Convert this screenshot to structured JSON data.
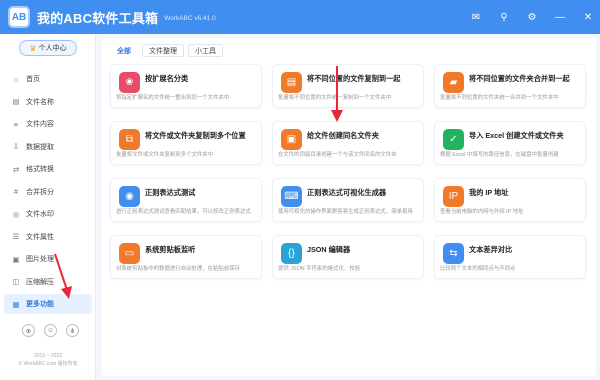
{
  "app": {
    "logo_text": "AB",
    "title": "我的ABC软件工具箱",
    "version": "WorkABC v6.41.0"
  },
  "window_controls": [
    {
      "name": "mail-icon",
      "glyph": "✉"
    },
    {
      "name": "pin-icon",
      "glyph": "⚲"
    },
    {
      "name": "settings-icon",
      "glyph": "⚙"
    },
    {
      "name": "minimize-icon",
      "glyph": "—"
    },
    {
      "name": "close-icon",
      "glyph": "✕"
    }
  ],
  "sidebar": {
    "vip_label": "个人中心",
    "items": [
      {
        "label": "首页",
        "icon": "⌂"
      },
      {
        "label": "文件名称",
        "icon": "▤"
      },
      {
        "label": "文件内容",
        "icon": "≡"
      },
      {
        "label": "数据提取",
        "icon": "⇩"
      },
      {
        "label": "格式转换",
        "icon": "⇄"
      },
      {
        "label": "合并拆分",
        "icon": "#"
      },
      {
        "label": "文件水印",
        "icon": "◎"
      },
      {
        "label": "文件属性",
        "icon": "☰"
      },
      {
        "label": "图片处理",
        "icon": "▣"
      },
      {
        "label": "压缩解压",
        "icon": "◫"
      },
      {
        "label": "更多功能",
        "icon": "▦",
        "active": true
      }
    ],
    "bottom_icons": [
      {
        "name": "link-icon",
        "glyph": "⊕"
      },
      {
        "name": "chat-icon",
        "glyph": "☺"
      },
      {
        "name": "share-icon",
        "glyph": "⋔"
      }
    ],
    "copyright_line1": "2013 ~ 2023",
    "copyright_line2": "© WorkABC.com 版权所有"
  },
  "tabs": [
    {
      "label": "全部",
      "active": true
    },
    {
      "label": "文件整理"
    },
    {
      "label": "小工具"
    }
  ],
  "cards": [
    {
      "title": "按扩展名分类",
      "desc": "将指定扩展名的文件统一整出到同一个文件夹中",
      "color": "pink",
      "glyph": "❀"
    },
    {
      "title": "将不同位置的文件复制到一起",
      "desc": "批量将不同位置的文件统一复制到一个文件夹中",
      "color": "orange",
      "glyph": "▤"
    },
    {
      "title": "将不同位置的文件夹合并到一起",
      "desc": "批量将不同位置的文件夹统一合并到一个文件夹中",
      "color": "orange",
      "glyph": "▰"
    },
    {
      "title": "将文件或文件夹复制到多个位置",
      "desc": "批量将文件或文件夹复制到多个文件夹中",
      "color": "orange",
      "glyph": "⧉"
    },
    {
      "title": "给文件创建同名文件夹",
      "desc": "在文件的同级目录创建一个与该文件同名的文件夹",
      "color": "orange",
      "glyph": "▣"
    },
    {
      "title": "导入 Excel 创建文件或文件夹",
      "desc": "根据 Excel 中填写的路径信息，在磁盘中批量创建",
      "color": "green",
      "glyph": "✓"
    },
    {
      "title": "正则表达式测试",
      "desc": "进行正则表达式测试查看匹配结果，可以修改正则表达式",
      "color": "blue",
      "glyph": "◉"
    },
    {
      "title": "正则表达式可视化生成器",
      "desc": "使用可视化的操作界面更容易生成正则表达式，简单易用",
      "color": "blue",
      "glyph": "⌨"
    },
    {
      "title": "我的 IP 地址",
      "desc": "查看当前电脑的内网与外网 IP 地址",
      "color": "orange",
      "glyph": "IP"
    },
    {
      "title": "系统剪贴板监听",
      "desc": "对系统剪贴板中的数据进行自动处理，在粘贴前保存",
      "color": "orange",
      "glyph": "▭"
    },
    {
      "title": "JSON 编辑器",
      "desc": "提供 JSON 字符串的格式化、校验",
      "color": "teal",
      "glyph": "{}"
    },
    {
      "title": "文本差异对比",
      "desc": "比较两个文本的相同点与不同点",
      "color": "blue",
      "glyph": "⇆"
    }
  ]
}
